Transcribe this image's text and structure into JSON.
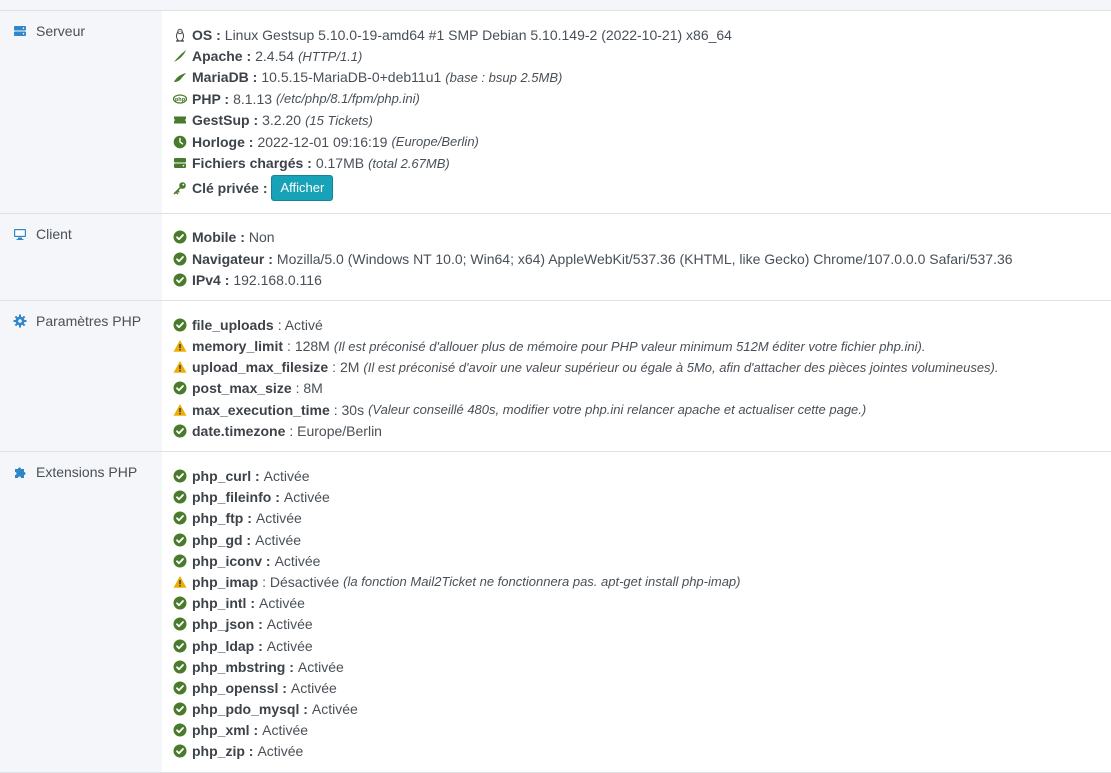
{
  "colors": {
    "ok": "#4a7a2c",
    "warn": "#f0ad00",
    "label_icon": "#2f86c9",
    "button": "#17a2b8"
  },
  "server": {
    "label": "Serveur",
    "icon": "server-icon",
    "items": [
      {
        "icon": "linux-icon",
        "key": "OS :",
        "value": "Linux Gestsup 5.10.0-19-amd64 #1 SMP Debian 5.10.149-2 (2022-10-21) x86_64",
        "note": ""
      },
      {
        "icon": "apache-feather-icon",
        "key": "Apache :",
        "value": "2.4.54",
        "note": "(HTTP/1.1)"
      },
      {
        "icon": "mariadb-icon",
        "key": "MariaDB :",
        "value": "10.5.15-MariaDB-0+deb11u1",
        "note": "(base : bsup 2.5MB)"
      },
      {
        "icon": "php-icon",
        "key": "PHP :",
        "value": "8.1.13",
        "note": "(/etc/php/8.1/fpm/php.ini)"
      },
      {
        "icon": "ticket-icon",
        "key": "GestSup :",
        "value": "3.2.20",
        "note": "(15 Tickets)"
      },
      {
        "icon": "clock-icon",
        "key": "Horloge :",
        "value": "2022-12-01 09:16:19",
        "note": "(Europe/Berlin)"
      },
      {
        "icon": "hdd-icon",
        "key": "Fichiers chargés :",
        "value": "0.17MB",
        "note": "(total 2.67MB)"
      }
    ],
    "private_key": {
      "icon": "key-icon",
      "key": "Clé privée :",
      "button_label": "Afficher"
    }
  },
  "client": {
    "label": "Client",
    "icon": "desktop-icon",
    "items": [
      {
        "status": "ok",
        "key": "Mobile :",
        "value": "Non",
        "note": ""
      },
      {
        "status": "ok",
        "key": "Navigateur :",
        "value": "Mozilla/5.0 (Windows NT 10.0; Win64; x64) AppleWebKit/537.36 (KHTML, like Gecko) Chrome/107.0.0.0 Safari/537.36",
        "note": ""
      },
      {
        "status": "ok",
        "key": "IPv4 :",
        "value": "192.168.0.116",
        "note": ""
      }
    ]
  },
  "php_params": {
    "label": "Paramètres PHP",
    "icon": "cog-icon",
    "items": [
      {
        "status": "ok",
        "key": "file_uploads",
        "value": ": Activé",
        "note": ""
      },
      {
        "status": "warn",
        "key": "memory_limit",
        "value": ": 128M",
        "note": "(Il est préconisé d'allouer plus de mémoire pour PHP valeur minimum 512M éditer votre fichier php.ini)."
      },
      {
        "status": "warn",
        "key": "upload_max_filesize",
        "value": ": 2M",
        "note": "(Il est préconisé d'avoir une valeur supérieur ou égale à 5Mo, afin d'attacher des pièces jointes volumineuses)."
      },
      {
        "status": "ok",
        "key": "post_max_size",
        "value": ": 8M",
        "note": ""
      },
      {
        "status": "warn",
        "key": "max_execution_time",
        "value": ": 30s",
        "note": "(Valeur conseillé 480s, modifier votre php.ini relancer apache et actualiser cette page.)"
      },
      {
        "status": "ok",
        "key": "date.timezone",
        "value": ": Europe/Berlin",
        "note": ""
      }
    ]
  },
  "php_ext": {
    "label": "Extensions PHP",
    "icon": "puzzle-icon",
    "items": [
      {
        "status": "ok",
        "key": "php_curl :",
        "value": "Activée",
        "note": ""
      },
      {
        "status": "ok",
        "key": "php_fileinfo :",
        "value": "Activée",
        "note": ""
      },
      {
        "status": "ok",
        "key": "php_ftp :",
        "value": "Activée",
        "note": ""
      },
      {
        "status": "ok",
        "key": "php_gd :",
        "value": "Activée",
        "note": ""
      },
      {
        "status": "ok",
        "key": "php_iconv :",
        "value": "Activée",
        "note": ""
      },
      {
        "status": "warn",
        "key": "php_imap",
        "value": ": Désactivée",
        "note": "(la fonction Mail2Ticket ne fonctionnera pas. apt-get install php-imap)"
      },
      {
        "status": "ok",
        "key": "php_intl :",
        "value": "Activée",
        "note": ""
      },
      {
        "status": "ok",
        "key": "php_json :",
        "value": "Activée",
        "note": ""
      },
      {
        "status": "ok",
        "key": "php_ldap :",
        "value": "Activée",
        "note": ""
      },
      {
        "status": "ok",
        "key": "php_mbstring :",
        "value": "Activée",
        "note": ""
      },
      {
        "status": "ok",
        "key": "php_openssl :",
        "value": "Activée",
        "note": ""
      },
      {
        "status": "ok",
        "key": "php_pdo_mysql :",
        "value": "Activée",
        "note": ""
      },
      {
        "status": "ok",
        "key": "php_xml :",
        "value": "Activée",
        "note": ""
      },
      {
        "status": "ok",
        "key": "php_zip :",
        "value": "Activée",
        "note": ""
      }
    ]
  }
}
